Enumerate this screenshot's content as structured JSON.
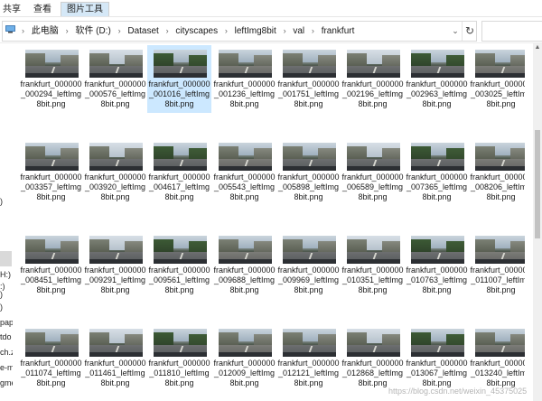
{
  "ribbon": {
    "tabs": [
      {
        "label": "共享"
      },
      {
        "label": "查看"
      },
      {
        "label": "图片工具",
        "active": true
      }
    ]
  },
  "address": {
    "crumbs": [
      "此电脑",
      "软件 (D:)",
      "Dataset",
      "cityscapes",
      "leftImg8bit",
      "val",
      "frankfurt"
    ],
    "refresh_icon": "↻",
    "dropdown_icon": "⌄"
  },
  "nav": {
    "items": [
      ")",
      ":)",
      "H:)",
      ")",
      ")",
      "pap",
      "tdo",
      "ch.z",
      "e-ma",
      "gme"
    ]
  },
  "files": [
    "frankfurt_000000_000294_leftImg8bit.png",
    "frankfurt_000000_000576_leftImg8bit.png",
    "frankfurt_000000_001016_leftImg8bit.png",
    "frankfurt_000000_001236_leftImg8bit.png",
    "frankfurt_000000_001751_leftImg8bit.png",
    "frankfurt_000000_002196_leftImg8bit.png",
    "frankfurt_000000_002963_leftImg8bit.png",
    "frankfurt_000000_003025_leftImg8bit.png",
    "frankfurt_000000_003357_leftImg8bit.png",
    "frankfurt_000000_003920_leftImg8bit.png",
    "frankfurt_000000_004617_leftImg8bit.png",
    "frankfurt_000000_005543_leftImg8bit.png",
    "frankfurt_000000_005898_leftImg8bit.png",
    "frankfurt_000000_006589_leftImg8bit.png",
    "frankfurt_000000_007365_leftImg8bit.png",
    "frankfurt_000000_008206_leftImg8bit.png",
    "frankfurt_000000_008451_leftImg8bit.png",
    "frankfurt_000000_009291_leftImg8bit.png",
    "frankfurt_000000_009561_leftImg8bit.png",
    "frankfurt_000000_009688_leftImg8bit.png",
    "frankfurt_000000_009969_leftImg8bit.png",
    "frankfurt_000000_010351_leftImg8bit.png",
    "frankfurt_000000_010763_leftImg8bit.png",
    "frankfurt_000000_011007_leftImg8bit.png",
    "frankfurt_000000_011074_leftImg8bit.png",
    "frankfurt_000000_011461_leftImg8bit.png",
    "frankfurt_000000_011810_leftImg8bit.png",
    "frankfurt_000000_012009_leftImg8bit.png",
    "frankfurt_000000_012121_leftImg8bit.png",
    "frankfurt_000000_012868_leftImg8bit.png",
    "frankfurt_000000_013067_leftImg8bit.png",
    "frankfurt_000000_013240_leftImg8bit.png"
  ],
  "selected_file": "frankfurt_000000_001016_leftImg8bit.png",
  "watermark": "https://blog.csdn.net/weixin_45375025",
  "colors": {
    "selection": "#cce8ff",
    "tab_active": "#d5e8f7"
  }
}
